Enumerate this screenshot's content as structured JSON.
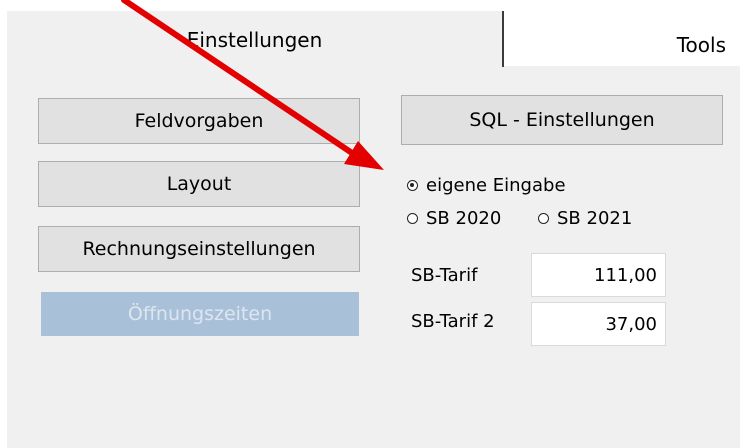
{
  "tabs": [
    {
      "label": "Einstellungen",
      "active": true
    },
    {
      "label": "Tools",
      "active": false
    }
  ],
  "left_buttons": {
    "feldvorgaben": "Feldvorgaben",
    "layout": "Layout",
    "rechnung": "Rechnungseinstellungen",
    "oeffnungszeiten": "Öffnungszeiten"
  },
  "sql_button": "SQL - Einstellungen",
  "radio_options": {
    "eigene": {
      "label": "eigene Eingabe",
      "checked": true
    },
    "sb2020": {
      "label": "SB 2020",
      "checked": false
    },
    "sb2021": {
      "label": "SB 2021",
      "checked": false
    }
  },
  "tariffs": {
    "sb_tarif": {
      "label": "SB-Tarif",
      "value": "111,00"
    },
    "sb_tarif_2": {
      "label": "SB-Tarif 2",
      "value": "37,00"
    }
  },
  "colors": {
    "panel": "#f0f0f0",
    "button": "#e1e1e1",
    "disabled_button": "#a9c0d9",
    "annotation_arrow": "#e30000"
  }
}
